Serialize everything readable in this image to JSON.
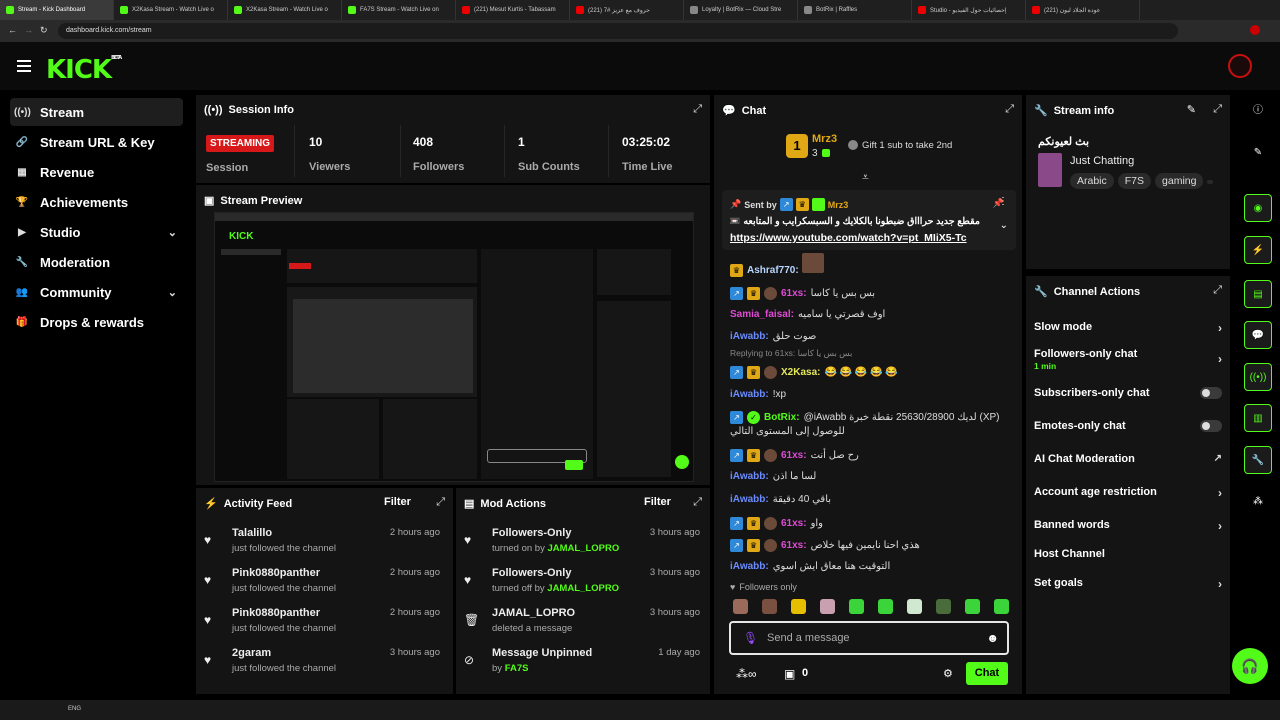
{
  "browser": {
    "tabs": [
      {
        "label": "Stream - Kick Dashboard",
        "icon": "kick-icon",
        "active": true
      },
      {
        "label": "X2Kasa Stream - Watch Live o",
        "icon": "kick-icon"
      },
      {
        "label": "X2Kasa Stream - Watch Live o",
        "icon": "kick-icon"
      },
      {
        "label": "FA7S Stream - Watch Live on",
        "icon": "kick-icon"
      },
      {
        "label": "(221) Mesut Kurtis - Tabassam",
        "icon": "youtube-icon"
      },
      {
        "label": "(221) حروف مع عزيز #7",
        "icon": "youtube-icon"
      },
      {
        "label": "Loyalty | BotRix — Cloud Stre",
        "icon": "botrix-icon"
      },
      {
        "label": "BotRix | Raffles",
        "icon": "botrix-icon"
      },
      {
        "label": "Studio - إحصائيات حول الفيديو",
        "icon": "youtube-icon"
      },
      {
        "label": "(221) عودة الجلاد ليون",
        "icon": "youtube-icon"
      }
    ],
    "url": "dashboard.kick.com/stream"
  },
  "header": {
    "logo": "KICK",
    "logo_tag": "BETA"
  },
  "sidebar": {
    "items": [
      {
        "label": "Stream",
        "icon": "broadcast-icon",
        "active": true
      },
      {
        "label": "Stream URL & Key",
        "icon": "link-icon"
      },
      {
        "label": "Revenue",
        "icon": "chart-icon"
      },
      {
        "label": "Achievements",
        "icon": "trophy-icon"
      },
      {
        "label": "Studio",
        "icon": "video-icon",
        "expandable": true
      },
      {
        "label": "Moderation",
        "icon": "wrench-icon"
      },
      {
        "label": "Community",
        "icon": "people-icon",
        "expandable": true
      },
      {
        "label": "Drops & rewards",
        "icon": "gift-icon"
      }
    ]
  },
  "session": {
    "title": "Session Info",
    "status": "STREAMING",
    "status_label": "Session",
    "stats": [
      {
        "value": "10",
        "label": "Viewers"
      },
      {
        "value": "408",
        "label": "Followers"
      },
      {
        "value": "1",
        "label": "Sub Counts"
      },
      {
        "value": "03:25:02",
        "label": "Time Live"
      }
    ]
  },
  "preview": {
    "title": "Stream Preview"
  },
  "activity": {
    "title": "Activity Feed",
    "filter": "Filter",
    "items": [
      {
        "name": "Talalillo",
        "desc": "just followed the channel",
        "time": "2 hours ago"
      },
      {
        "name": "Pink0880panther",
        "desc": "just followed the channel",
        "time": "2 hours ago"
      },
      {
        "name": "Pink0880panther",
        "desc": "just followed the channel",
        "time": "2 hours ago"
      },
      {
        "name": "2garam",
        "desc": "just followed the channel",
        "time": "3 hours ago"
      }
    ]
  },
  "mod": {
    "title": "Mod Actions",
    "filter": "Filter",
    "items": [
      {
        "title": "Followers-Only",
        "prefix": "turned on by",
        "user": "JAMAL_LOPRO",
        "time": "3 hours ago",
        "icon": "heart-icon"
      },
      {
        "title": "Followers-Only",
        "prefix": "turned off by",
        "user": "JAMAL_LOPRO",
        "time": "3 hours ago",
        "icon": "heart-icon"
      },
      {
        "title": "JAMAL_LOPRO",
        "prefix": "deleted a message",
        "user": "",
        "time": "3 hours ago",
        "icon": "trash-icon"
      },
      {
        "title": "Message Unpinned",
        "prefix": "by",
        "user": "FA7S",
        "time": "1 day ago",
        "icon": "unpin-icon"
      }
    ]
  },
  "chat": {
    "title": "Chat",
    "top_gifter": {
      "name": "Mrz3",
      "count": "3",
      "rank": "1"
    },
    "gift_cta": "Gift 1 sub to take 2nd",
    "pinned": {
      "sent_by": "Sent by",
      "user": "Mrz3",
      "text": "مقطع جديد حراااق ضبطونا بالكلايك و السبسكرايب و المتابعه 📼:",
      "link": "https://www.youtube.com/watch?v=pt_MIiX5-Tc"
    },
    "messages": [
      {
        "user": "Ashraf770:",
        "text": "",
        "color": "#b9d6ff",
        "badges": [
          "gold"
        ]
      },
      {
        "user": "61xs:",
        "text": "بس بس يا كاسا",
        "color": "#e04bd6",
        "badges": [
          "blue",
          "gold",
          "av"
        ]
      },
      {
        "user": "Samia_faisal:",
        "text": "اوف قصرتي يا ساميه",
        "color": "#e04bd6",
        "badges": []
      },
      {
        "user": "iAwabb:",
        "text": "صوت حلق",
        "color": "#6b8cff",
        "badges": []
      },
      {
        "user": "X2Kasa:",
        "text": "😂 😂 😂 😂 😂",
        "color": "#e6e85a",
        "badges": [
          "blue",
          "gold",
          "av"
        ],
        "reply": "Replying to 61xs: بس بس يا كاسا"
      },
      {
        "user": "iAwabb:",
        "text": "!xp",
        "color": "#6b8cff",
        "badges": []
      },
      {
        "user": "BotRix:",
        "text": "@iAwabb لديك 25630/28900 نقطة خبرة (XP)",
        "text2": "للوصول إلى المستوى التالي",
        "color": "#53fc18",
        "badges": [
          "blue",
          "verified"
        ]
      },
      {
        "user": "61xs:",
        "text": "رح صل أنت",
        "color": "#e04bd6",
        "badges": [
          "blue",
          "gold",
          "av"
        ]
      },
      {
        "user": "iAwabb:",
        "text": "لسا ما اذن",
        "color": "#6b8cff",
        "badges": []
      },
      {
        "user": "iAwabb:",
        "text": "باقي 40 دقيقة",
        "color": "#6b8cff",
        "badges": []
      },
      {
        "user": "61xs:",
        "text": "واو",
        "color": "#e04bd6",
        "badges": [
          "blue",
          "gold",
          "av"
        ]
      },
      {
        "user": "61xs:",
        "text": "هذي احنا نايمين فيها خلاص",
        "color": "#e04bd6",
        "badges": [
          "blue",
          "gold",
          "av"
        ]
      },
      {
        "user": "iAwabb:",
        "text": "التوقيت هنا معاق ايش اسوي",
        "color": "#6b8cff",
        "badges": []
      }
    ],
    "followers_only": "Followers only",
    "input_placeholder": "Send a message",
    "points": "0",
    "send_label": "Chat"
  },
  "stream_info": {
    "title": "Stream info",
    "stream_title": "بث لعيونكم",
    "category": "Just Chatting",
    "tags": [
      "Arabic",
      "F7S",
      "gaming"
    ]
  },
  "channel_actions": {
    "title": "Channel Actions",
    "items": [
      {
        "label": "Slow mode",
        "control": "chevron"
      },
      {
        "label": "Followers-only chat",
        "sub": "1 min",
        "control": "chevron"
      },
      {
        "label": "Subscribers-only chat",
        "control": "toggle"
      },
      {
        "label": "Emotes-only chat",
        "control": "toggle"
      },
      {
        "label": "AI Chat Moderation",
        "control": "external"
      },
      {
        "label": "Account age restriction",
        "control": "chevron"
      },
      {
        "label": "Banned words",
        "control": "chevron"
      },
      {
        "label": "Host Channel",
        "control": "none"
      },
      {
        "label": "Set goals",
        "control": "chevron"
      }
    ]
  },
  "colors": {
    "accent": "#53fc18",
    "streaming": "#d61818",
    "panel": "#141414"
  },
  "taskbar": {
    "lang": "ENG"
  }
}
